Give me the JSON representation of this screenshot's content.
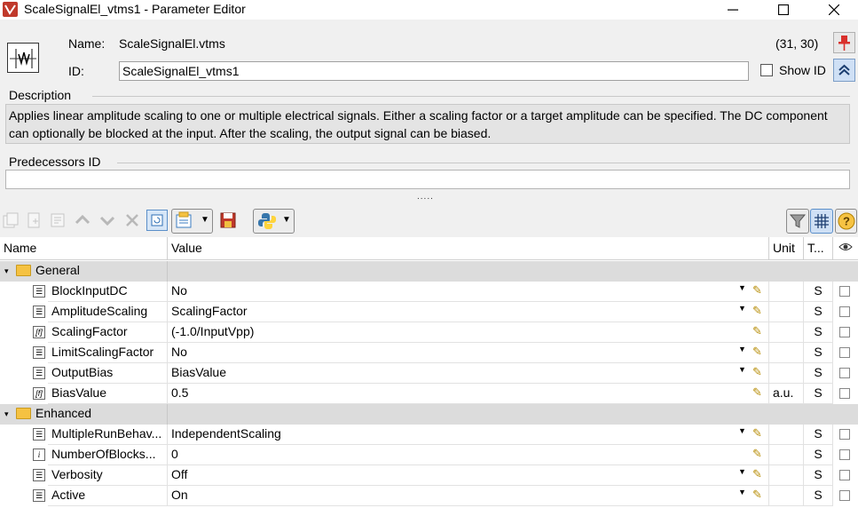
{
  "window": {
    "title": "ScaleSignalEl_vtms1 - Parameter Editor",
    "minimize": "—",
    "maximize": "☐",
    "close": "✕"
  },
  "header": {
    "name_label": "Name:",
    "name_value": "ScaleSignalEl.vtms",
    "coords": "(31, 30)",
    "id_label": "ID:",
    "id_value": "ScaleSignalEl_vtms1",
    "show_id_label": "Show ID"
  },
  "description": {
    "label": "Description",
    "text": "Applies linear amplitude scaling to one or multiple electrical signals. Either a scaling factor or a target amplitude can be specified. The DC component can optionally be blocked at the input. After the scaling, the output signal can be biased."
  },
  "predecessors": {
    "label": "Predecessors ID",
    "value": ""
  },
  "splitter": ".....",
  "table": {
    "headers": {
      "name": "Name",
      "value": "Value",
      "unit": "Unit",
      "type": "T...",
      "visible": "👁"
    },
    "groups": [
      {
        "label": "General",
        "rows": [
          {
            "name": "BlockInputDC",
            "value": "No",
            "unit": "",
            "type": "S",
            "kind": "list"
          },
          {
            "name": "AmplitudeScaling",
            "value": "ScalingFactor",
            "unit": "",
            "type": "S",
            "kind": "list"
          },
          {
            "name": "ScalingFactor",
            "value": "(-1.0/InputVpp)",
            "unit": "",
            "type": "S",
            "kind": "formula"
          },
          {
            "name": "LimitScalingFactor",
            "value": "No",
            "unit": "",
            "type": "S",
            "kind": "list"
          },
          {
            "name": "OutputBias",
            "value": "BiasValue",
            "unit": "",
            "type": "S",
            "kind": "list"
          },
          {
            "name": "BiasValue",
            "value": "0.5",
            "unit": "a.u.",
            "type": "S",
            "kind": "formula"
          }
        ]
      },
      {
        "label": "Enhanced",
        "rows": [
          {
            "name": "MultipleRunBehav...",
            "value": "IndependentScaling",
            "unit": "",
            "type": "S",
            "kind": "list"
          },
          {
            "name": "NumberOfBlocks...",
            "value": "0",
            "unit": "",
            "type": "S",
            "kind": "int"
          },
          {
            "name": "Verbosity",
            "value": "Off",
            "unit": "",
            "type": "S",
            "kind": "list"
          },
          {
            "name": "Active",
            "value": "On",
            "unit": "",
            "type": "S",
            "kind": "list"
          }
        ]
      }
    ]
  },
  "colors": {
    "group_row": "#dcdcdc",
    "folder": "#f5c242",
    "pin": "#d9302c",
    "accent_blue": "#cfe0f5"
  }
}
